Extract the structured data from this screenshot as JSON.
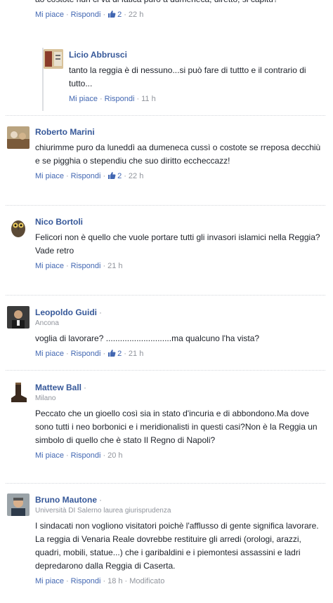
{
  "top_comment": {
    "text": "ao costote nun ci va di fatica puro a dumeneca, diretto, si capitu?",
    "like": "Mi piace",
    "reply": "Rispondi",
    "likes": "2",
    "time": "22 h"
  },
  "reply": {
    "author": "Licio Abbrusci",
    "text": "tanto la reggia è di nessuno...si può fare di tuttto e il contrario di tutto...",
    "like": "Mi piace",
    "reply": "Rispondi",
    "time": "11 h"
  },
  "comments": [
    {
      "author": "Roberto Marini",
      "text": "chiurimme puro da luneddì aa dumeneca cussì o costote se rreposa decchiù e se pigghia o stependiu che suo diritto eccheccazz!",
      "like": "Mi piace",
      "reply": "Rispondi",
      "likes": "2",
      "time": "22 h"
    },
    {
      "author": "Nico Bortoli",
      "text": "Felicori non è quello che vuole portare tutti gli invasori islamici nella Reggia?\nVade retro",
      "like": "Mi piace",
      "reply": "Rispondi",
      "time": "21 h"
    },
    {
      "author": "Leopoldo Guidi",
      "location": "Ancona",
      "text": "voglia di lavorare? ............................ma qualcuno l'ha vista?",
      "like": "Mi piace",
      "reply": "Rispondi",
      "likes": "2",
      "time": "21 h"
    },
    {
      "author": "Mattew Ball",
      "location": "Milano",
      "text": "Peccato che un gioello così sia in stato d'incuria e di abbondono.Ma dove sono tutti i neo borbonici e i meridionalisti in questi casi?Non è la Reggia un simbolo di quello che è stato Il Regno di Napoli?",
      "like": "Mi piace",
      "reply": "Rispondi",
      "time": "20 h"
    },
    {
      "author": "Bruno Mautone",
      "location": "Università DI Salerno laurea giurisprudenza",
      "text": "I sindacati non vogliono visitatori poichè l'afflusso di gente significa lavorare. La reggia di Venaria Reale dovrebbe restituire gli arredi (orologi, arazzi, quadri, mobili, statue...) che i garibaldini e i piemontesi assassini e ladri depredarono dalla Reggia di Caserta.",
      "like": "Mi piace",
      "reply": "Rispondi",
      "time": "18 h",
      "edited": "Modificato"
    }
  ],
  "separator_dot": "·",
  "colors": {
    "link": "#4267b2",
    "author": "#365899",
    "meta": "#90949c",
    "text": "#1d2129"
  }
}
